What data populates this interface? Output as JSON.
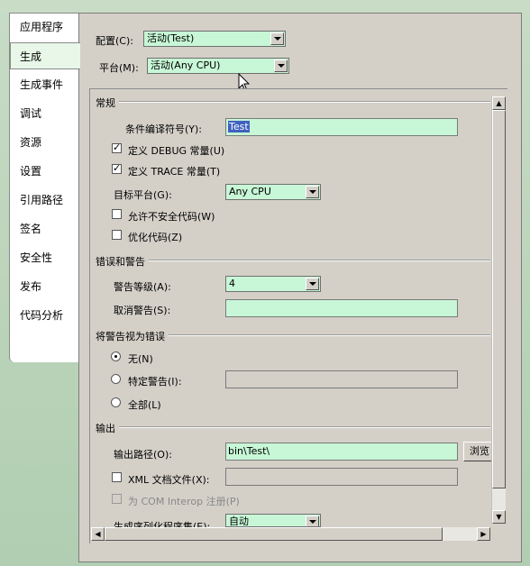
{
  "tabs": [
    "应用程序",
    "生成",
    "生成事件",
    "调试",
    "资源",
    "设置",
    "引用路径",
    "签名",
    "安全性",
    "发布",
    "代码分析"
  ],
  "active_tab": "生成",
  "config": {
    "label": "配置(C):",
    "value": "活动(Test)"
  },
  "platform": {
    "label": "平台(M):",
    "value": "活动(Any CPU)"
  },
  "sections": {
    "general": "常规",
    "errors": "错误和警告",
    "treat_warnings": "将警告视为错误",
    "output": "输出"
  },
  "general": {
    "conditional_symbols_label": "条件编译符号(Y):",
    "conditional_symbols_value": "Test",
    "define_debug": "定义 DEBUG 常量(U)",
    "define_trace": "定义 TRACE 常量(T)",
    "target_platform_label": "目标平台(G):",
    "target_platform_value": "Any CPU",
    "allow_unsafe": "允许不安全代码(W)",
    "optimize": "优化代码(Z)"
  },
  "errors": {
    "warning_level_label": "警告等级(A):",
    "warning_level_value": "4",
    "suppress_label": "取消警告(S):",
    "suppress_value": ""
  },
  "treat": {
    "none": "无(N)",
    "specific": "特定警告(I):",
    "all": "全部(L)"
  },
  "output": {
    "path_label": "输出路径(O):",
    "path_value": "bin\\Test\\",
    "browse": "浏览",
    "xml_doc": "XML 文档文件(X):",
    "com_interop": "为 COM Interop 注册(P)",
    "serialization_label": "生成序列化程序集(E):",
    "serialization_value": "自动"
  },
  "colors": {
    "field_bg": "#c7f7d6",
    "panel_bg": "#d4d0c8",
    "window_bg": "#b9d3b8"
  }
}
